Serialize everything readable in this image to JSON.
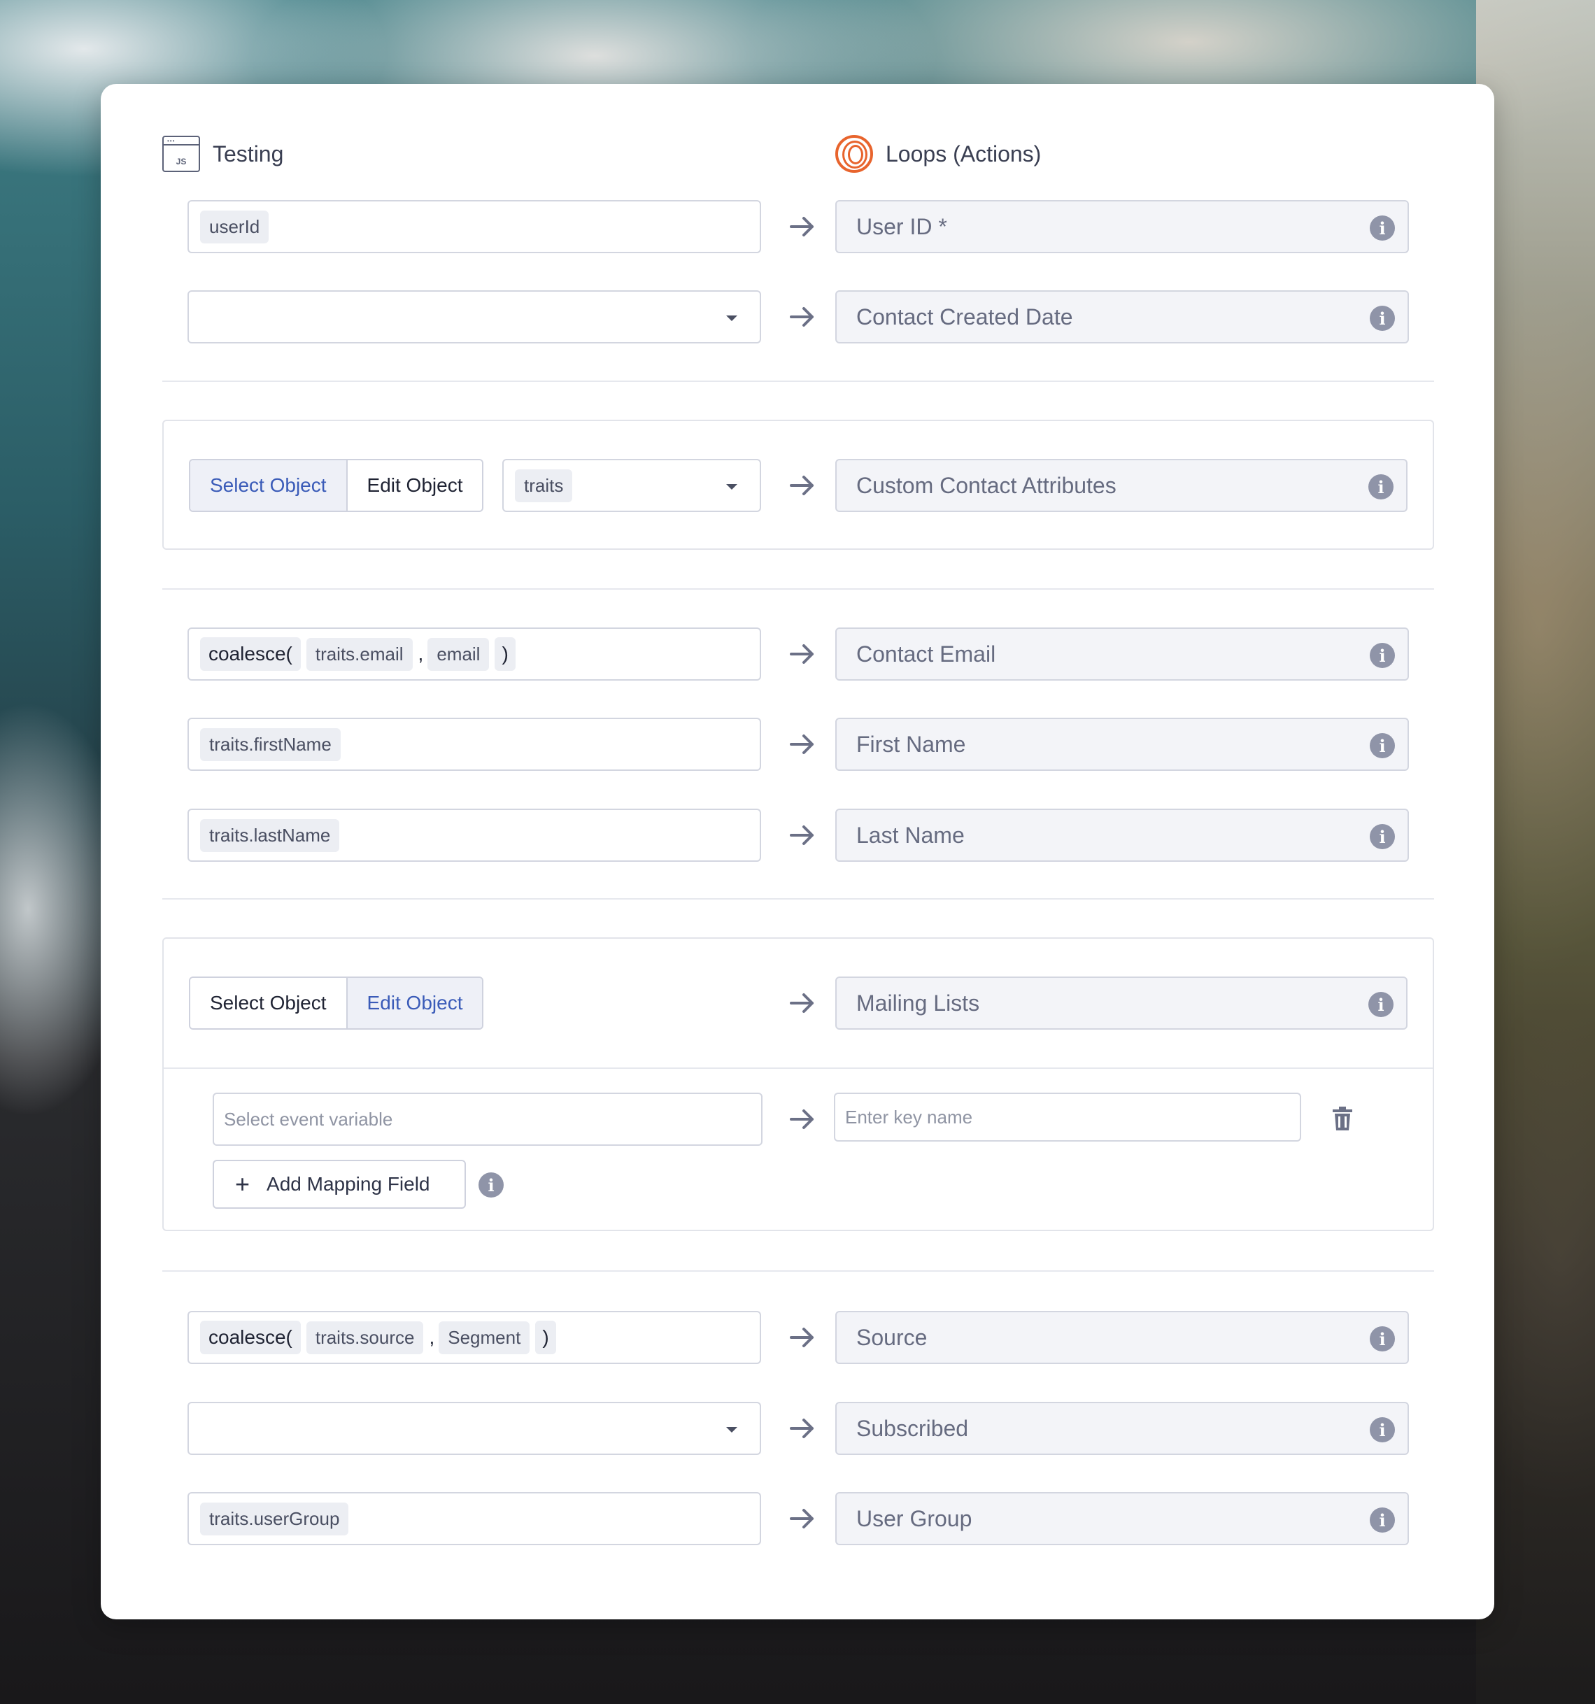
{
  "source": {
    "name": "Testing",
    "icon": "js-file-icon",
    "icon_label": "JS"
  },
  "destination": {
    "name": "Loops (Actions)",
    "icon": "loops-logo-icon",
    "brand_color": "#e8642d"
  },
  "mappings": [
    {
      "source_tokens": [
        "userId"
      ],
      "target": "User ID *"
    },
    {
      "source_tokens": [],
      "source_type": "dropdown",
      "target": "Contact Created Date"
    }
  ],
  "object_mapping_1": {
    "tabs": [
      "Select Object",
      "Edit Object"
    ],
    "active_tab": "Select Object",
    "selected_value": "traits",
    "target": "Custom Contact Attributes"
  },
  "mappings_2": [
    {
      "fn": "coalesce(",
      "args": [
        "traits.email",
        "email"
      ],
      "close": ")",
      "target": "Contact Email"
    },
    {
      "source_tokens": [
        "traits.firstName"
      ],
      "target": "First Name"
    },
    {
      "source_tokens": [
        "traits.lastName"
      ],
      "target": "Last Name"
    }
  ],
  "object_mapping_2": {
    "tabs": [
      "Select Object",
      "Edit Object"
    ],
    "active_tab": "Edit Object",
    "target": "Mailing Lists",
    "event_variable_placeholder": "Select event variable",
    "key_name_placeholder": "Enter key name",
    "add_button_label": "Add Mapping Field"
  },
  "mappings_3": [
    {
      "fn": "coalesce(",
      "args": [
        "traits.source",
        "Segment"
      ],
      "close": ")",
      "target": "Source"
    },
    {
      "source_tokens": [],
      "source_type": "dropdown",
      "target": "Subscribed"
    },
    {
      "source_tokens": [
        "traits.userGroup"
      ],
      "target": "User Group"
    }
  ],
  "colors": {
    "accent": "#3a5bb8",
    "field_border": "#d3d6e0",
    "target_bg": "#f3f4f8",
    "info_icon": "#8f94a8"
  }
}
